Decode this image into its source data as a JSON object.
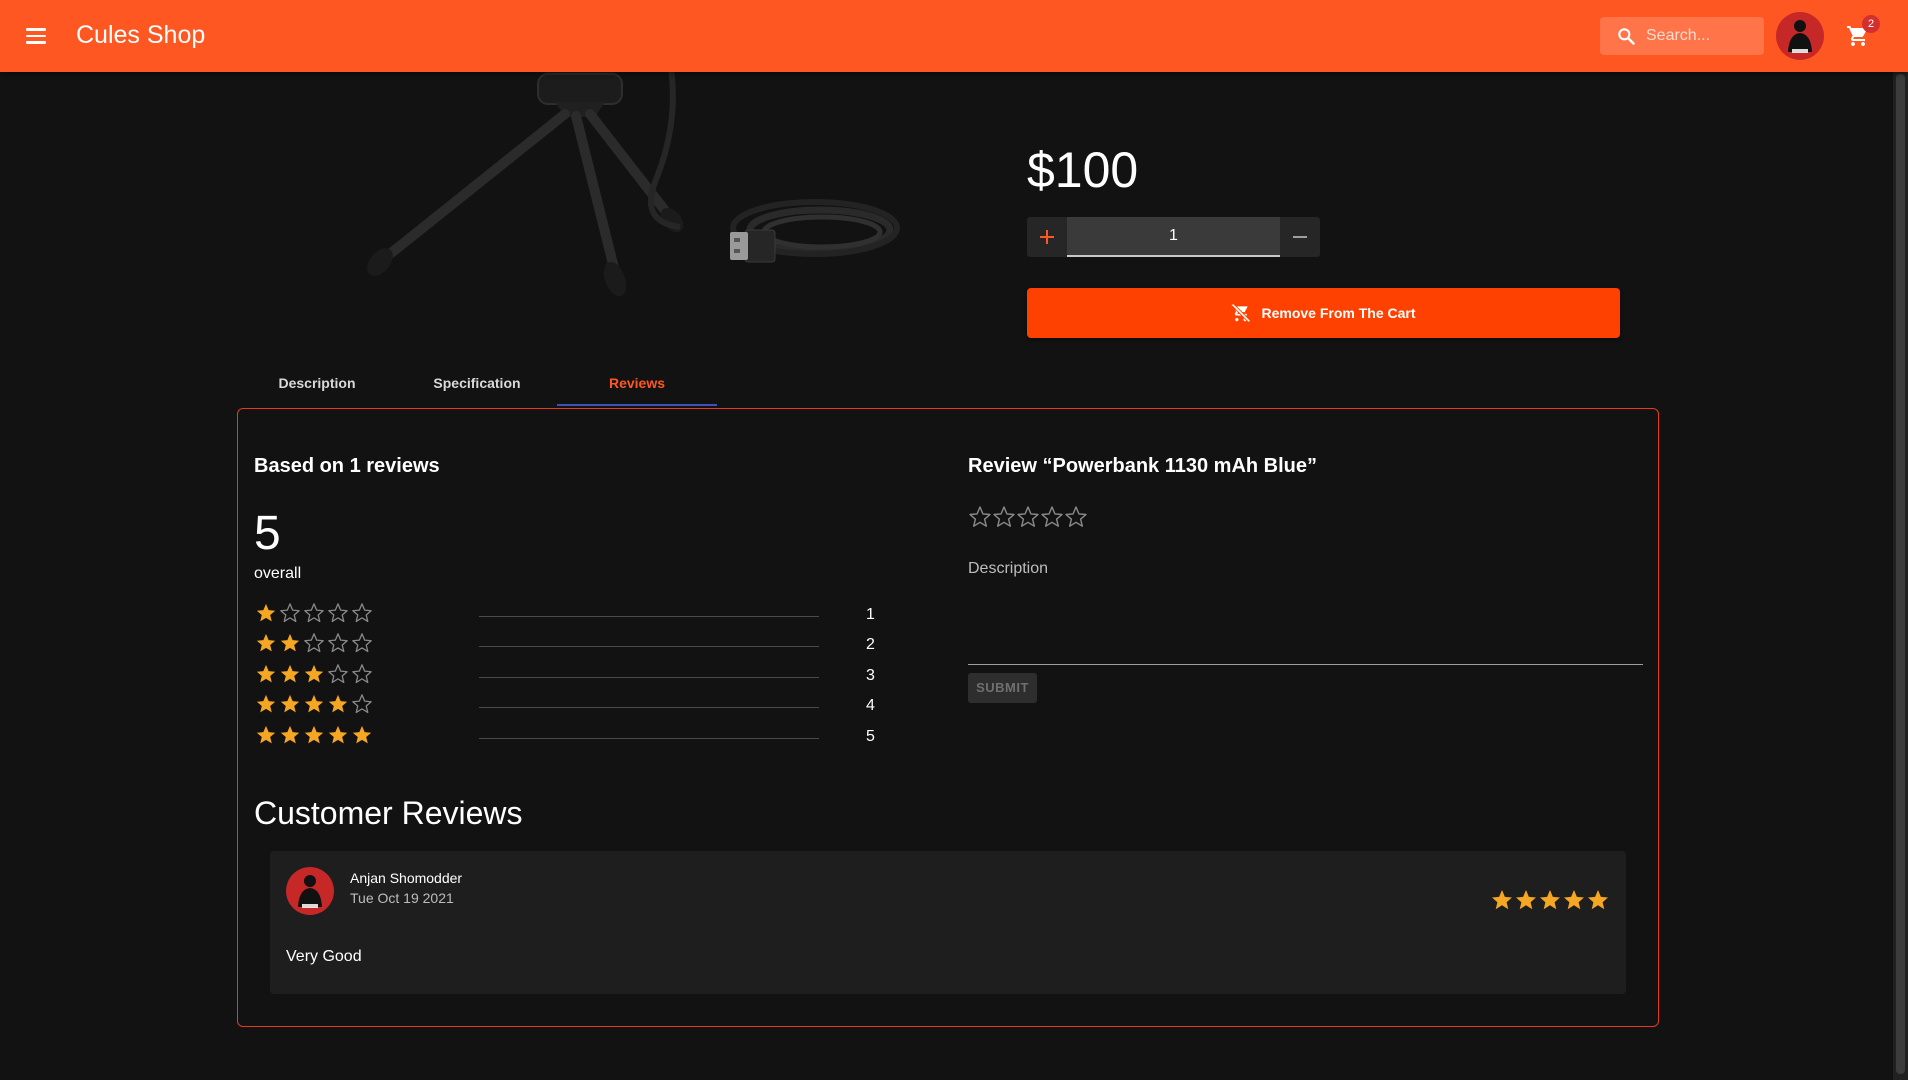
{
  "header": {
    "title": "Cules Shop",
    "search_placeholder": "Search...",
    "cart_count": "2",
    "background_color": "#ff5722"
  },
  "product": {
    "price": "$100",
    "quantity": "1",
    "remove_label": "Remove From The Cart"
  },
  "tabs": [
    {
      "label": "Description"
    },
    {
      "label": "Specification"
    },
    {
      "label": "Reviews",
      "active": true
    }
  ],
  "reviews_summary": {
    "based_on": "Based on 1 reviews",
    "overall_value": "5",
    "overall_label": "overall",
    "rows": [
      {
        "stars": 1,
        "count": "1",
        "fill": 0
      },
      {
        "stars": 2,
        "count": "2",
        "fill": 0
      },
      {
        "stars": 3,
        "count": "3",
        "fill": 0
      },
      {
        "stars": 4,
        "count": "4",
        "fill": 0
      },
      {
        "stars": 5,
        "count": "5",
        "fill": 0
      }
    ]
  },
  "write_review": {
    "title": "Review “Powerbank 1130 mAh Blue”",
    "rating": 0,
    "description_label": "Description",
    "description_value": "",
    "submit_label": "SUBMIT"
  },
  "customer_reviews": {
    "title": "Customer Reviews",
    "items": [
      {
        "name": "Anjan Shomodder",
        "date": "Tue Oct 19 2021",
        "rating": 5,
        "text": "Very Good"
      }
    ]
  },
  "colors": {
    "accent": "#ff5722",
    "button": "#ff4100",
    "star": "#f5a623",
    "panel_border": "#e53a1e",
    "tab_indicator": "#3f51b5"
  }
}
